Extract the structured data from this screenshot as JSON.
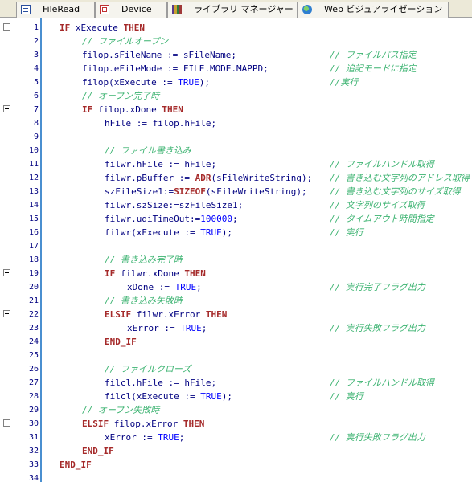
{
  "tabs": [
    {
      "label": "FileRead",
      "icon": "document-icon"
    },
    {
      "label": "Device",
      "icon": "device-icon"
    },
    {
      "label": "ライブラリ マネージャー",
      "icon": "library-books-icon"
    },
    {
      "label": "Web ビジュアライゼーション",
      "icon": "web-globe-icon"
    }
  ],
  "colors": {
    "keyword": "#a52a2a",
    "identifier": "#000080",
    "literal": "#0000ff",
    "comment": "#3cb371",
    "gutter_border": "#4a8fd0",
    "line_number": "#000080"
  },
  "lines": [
    {
      "n": "1",
      "fold": true,
      "indent": 1,
      "tokens": [
        {
          "t": "IF",
          "c": "kw"
        },
        {
          "t": " xExecute ",
          "c": "id"
        },
        {
          "t": "THEN",
          "c": "kw"
        }
      ],
      "comment": ""
    },
    {
      "n": "2",
      "fold": false,
      "indent": 2,
      "tokens": [
        {
          "t": "// ファイルオープン",
          "c": "cm"
        }
      ],
      "comment": ""
    },
    {
      "n": "3",
      "fold": false,
      "indent": 2,
      "tokens": [
        {
          "t": "filop.sFileName := sFileName;",
          "c": "id"
        }
      ],
      "comment": "// ファイルパス指定"
    },
    {
      "n": "4",
      "fold": false,
      "indent": 2,
      "tokens": [
        {
          "t": "filop.eFileMode := FILE.MODE.MAPPD;",
          "c": "id"
        }
      ],
      "comment": "// 追記モードに指定"
    },
    {
      "n": "5",
      "fold": false,
      "indent": 2,
      "tokens": [
        {
          "t": "filop(xExecute := ",
          "c": "id"
        },
        {
          "t": "TRUE",
          "c": "lit"
        },
        {
          "t": ");",
          "c": "id"
        }
      ],
      "comment": "//実行"
    },
    {
      "n": "6",
      "fold": false,
      "indent": 2,
      "tokens": [
        {
          "t": "// オープン完了時",
          "c": "cm"
        }
      ],
      "comment": ""
    },
    {
      "n": "7",
      "fold": true,
      "indent": 2,
      "tokens": [
        {
          "t": "IF",
          "c": "kw"
        },
        {
          "t": " filop.xDone ",
          "c": "id"
        },
        {
          "t": "THEN",
          "c": "kw"
        }
      ],
      "comment": ""
    },
    {
      "n": "8",
      "fold": false,
      "indent": 3,
      "tokens": [
        {
          "t": "hFile := filop.hFile;",
          "c": "id"
        }
      ],
      "comment": ""
    },
    {
      "n": "9",
      "fold": false,
      "indent": 3,
      "tokens": [],
      "comment": ""
    },
    {
      "n": "10",
      "fold": false,
      "indent": 3,
      "tokens": [
        {
          "t": "// ファイル書き込み",
          "c": "cm"
        }
      ],
      "comment": ""
    },
    {
      "n": "11",
      "fold": false,
      "indent": 3,
      "tokens": [
        {
          "t": "filwr.hFile := hFile;",
          "c": "id"
        }
      ],
      "comment": "// ファイルハンドル取得"
    },
    {
      "n": "12",
      "fold": false,
      "indent": 3,
      "tokens": [
        {
          "t": "filwr.pBuffer := ",
          "c": "id"
        },
        {
          "t": "ADR",
          "c": "kw"
        },
        {
          "t": "(sFileWriteString);",
          "c": "id"
        }
      ],
      "comment": "// 書き込む文字列のアドレス取得"
    },
    {
      "n": "13",
      "fold": false,
      "indent": 3,
      "tokens": [
        {
          "t": "szFileSize1:=",
          "c": "id"
        },
        {
          "t": "SIZEOF",
          "c": "kw"
        },
        {
          "t": "(sFileWriteString);",
          "c": "id"
        }
      ],
      "comment": "// 書き込む文字列のサイズ取得"
    },
    {
      "n": "14",
      "fold": false,
      "indent": 3,
      "tokens": [
        {
          "t": "filwr.szSize:=szFileSize1;",
          "c": "id"
        }
      ],
      "comment": "// 文字列のサイズ取得"
    },
    {
      "n": "15",
      "fold": false,
      "indent": 3,
      "tokens": [
        {
          "t": "filwr.udiTimeOut:=",
          "c": "id"
        },
        {
          "t": "100000",
          "c": "num"
        },
        {
          "t": ";",
          "c": "id"
        }
      ],
      "comment": "// タイムアウト時間指定"
    },
    {
      "n": "16",
      "fold": false,
      "indent": 3,
      "tokens": [
        {
          "t": "filwr(xExecute := ",
          "c": "id"
        },
        {
          "t": "TRUE",
          "c": "lit"
        },
        {
          "t": ");",
          "c": "id"
        }
      ],
      "comment": "// 実行"
    },
    {
      "n": "17",
      "fold": false,
      "indent": 3,
      "tokens": [],
      "comment": ""
    },
    {
      "n": "18",
      "fold": false,
      "indent": 3,
      "tokens": [
        {
          "t": "// 書き込み完了時",
          "c": "cm"
        }
      ],
      "comment": ""
    },
    {
      "n": "19",
      "fold": true,
      "indent": 3,
      "tokens": [
        {
          "t": "IF",
          "c": "kw"
        },
        {
          "t": " filwr.xDone ",
          "c": "id"
        },
        {
          "t": "THEN",
          "c": "kw"
        }
      ],
      "comment": ""
    },
    {
      "n": "20",
      "fold": false,
      "indent": 4,
      "tokens": [
        {
          "t": "xDone := ",
          "c": "id"
        },
        {
          "t": "TRUE",
          "c": "lit"
        },
        {
          "t": ";",
          "c": "id"
        }
      ],
      "comment": "// 実行完了フラグ出力"
    },
    {
      "n": "21",
      "fold": false,
      "indent": 3,
      "tokens": [
        {
          "t": "// 書き込み失敗時",
          "c": "cm"
        }
      ],
      "comment": ""
    },
    {
      "n": "22",
      "fold": true,
      "indent": 3,
      "tokens": [
        {
          "t": "ELSIF",
          "c": "kw"
        },
        {
          "t": " filwr.xError ",
          "c": "id"
        },
        {
          "t": "THEN",
          "c": "kw"
        }
      ],
      "comment": ""
    },
    {
      "n": "23",
      "fold": false,
      "indent": 4,
      "tokens": [
        {
          "t": "xError := ",
          "c": "id"
        },
        {
          "t": "TRUE",
          "c": "lit"
        },
        {
          "t": ";",
          "c": "id"
        }
      ],
      "comment": "// 実行失敗フラグ出力"
    },
    {
      "n": "24",
      "fold": false,
      "indent": 3,
      "tokens": [
        {
          "t": "END_IF",
          "c": "kw"
        }
      ],
      "comment": ""
    },
    {
      "n": "25",
      "fold": false,
      "indent": 3,
      "tokens": [],
      "comment": ""
    },
    {
      "n": "26",
      "fold": false,
      "indent": 3,
      "tokens": [
        {
          "t": "// ファイルクローズ",
          "c": "cm"
        }
      ],
      "comment": ""
    },
    {
      "n": "27",
      "fold": false,
      "indent": 3,
      "tokens": [
        {
          "t": "filcl.hFile := hFile;",
          "c": "id"
        }
      ],
      "comment": "// ファイルハンドル取得"
    },
    {
      "n": "28",
      "fold": false,
      "indent": 3,
      "tokens": [
        {
          "t": "filcl(xExecute := ",
          "c": "id"
        },
        {
          "t": "TRUE",
          "c": "lit"
        },
        {
          "t": ");",
          "c": "id"
        }
      ],
      "comment": "// 実行"
    },
    {
      "n": "29",
      "fold": false,
      "indent": 2,
      "tokens": [
        {
          "t": "// オープン失敗時",
          "c": "cm"
        }
      ],
      "comment": ""
    },
    {
      "n": "30",
      "fold": true,
      "indent": 2,
      "tokens": [
        {
          "t": "ELSIF",
          "c": "kw"
        },
        {
          "t": " filop.xError ",
          "c": "id"
        },
        {
          "t": "THEN",
          "c": "kw"
        }
      ],
      "comment": ""
    },
    {
      "n": "31",
      "fold": false,
      "indent": 3,
      "tokens": [
        {
          "t": "xError := ",
          "c": "id"
        },
        {
          "t": "TRUE",
          "c": "lit"
        },
        {
          "t": ";",
          "c": "id"
        }
      ],
      "comment": "// 実行失敗フラグ出力"
    },
    {
      "n": "32",
      "fold": false,
      "indent": 2,
      "tokens": [
        {
          "t": "END_IF",
          "c": "kw"
        }
      ],
      "comment": ""
    },
    {
      "n": "33",
      "fold": false,
      "indent": 1,
      "tokens": [
        {
          "t": "END_IF",
          "c": "kw"
        }
      ],
      "comment": ""
    },
    {
      "n": "34",
      "fold": false,
      "indent": 1,
      "tokens": [],
      "comment": ""
    }
  ]
}
